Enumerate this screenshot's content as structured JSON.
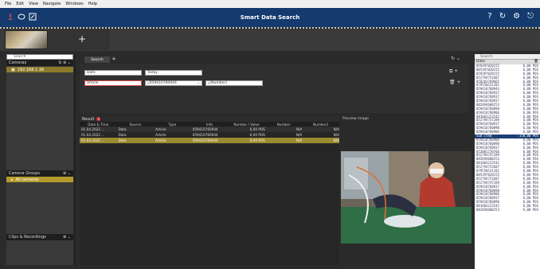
{
  "menu": [
    "File",
    "Edit",
    "View",
    "Navigate",
    "Windows",
    "Help"
  ],
  "app_title": "Smart Data Search",
  "title_right_icons": [
    "?",
    "↻",
    "⚙",
    "⎋"
  ],
  "add_tab": "+",
  "left": {
    "search_placeholder": "Search",
    "cameras_label": "Cameras",
    "camera_ip": "192.168.1.36",
    "camera_groups_label": "Camera Groups",
    "all_cameras": "All cameras",
    "clips_label": "Clips & Recordings"
  },
  "filter": {
    "tab_label": "Search",
    "tab_plus": "+",
    "field1_a": "Date",
    "field1_b": "Today",
    "field2_a": "Article",
    "field2_b": "059410760944",
    "field2_c": "(Number)"
  },
  "result": {
    "label": "Result",
    "count": "3",
    "columns": [
      "Date & Time",
      "Source",
      "Type",
      "Info",
      "Number / Value",
      "Number",
      "Number2"
    ],
    "rows": [
      [
        "01.04.2022 ...",
        "Data",
        "Article",
        "059410760944",
        "6,00 POS",
        "N/A",
        "N/A"
      ],
      [
        "01.04.2022 ...",
        "Data",
        "Article",
        "059410760944",
        "6,00 POS",
        "N/A",
        "N/A"
      ],
      [
        "01.04.2022 ...",
        "Data",
        "Article",
        "059410760944",
        "6,00 POS",
        "N/A",
        "N/A"
      ]
    ]
  },
  "preview": {
    "label": "Preview image"
  },
  "right": {
    "search_placeholder": "Search",
    "col_data": "Data",
    "rows": [
      [
        "059397020155",
        "6,00 POS"
      ],
      [
        "005397020155",
        "6,00 POS"
      ],
      [
        "059397020155",
        "6,00 POS"
      ],
      [
        "052794752687",
        "6,00 POS"
      ],
      [
        "058203769665",
        "6,00 POS"
      ],
      [
        "079550531281",
        "6,00 POS"
      ],
      [
        "059410760944",
        "6,00 POS"
      ],
      [
        "059410760937",
        "6,00 POS"
      ],
      [
        "059410760937",
        "6,00 POS"
      ],
      [
        "059410760937",
        "6,00 POS"
      ],
      [
        "082694608253",
        "6,00 POS"
      ],
      [
        "059410760890",
        "6,00 POS"
      ],
      [
        "059410760906",
        "6,00 POS"
      ],
      [
        "081603223542",
        "6,00 POS"
      ],
      [
        "052794747289",
        "6,00 POS"
      ],
      [
        "059410760937",
        "6,00 POS"
      ],
      [
        "059410760890",
        "6,00 POS"
      ],
      [
        "059410760906",
        "6,00 POS"
      ],
      [
        "Sum item",
        "-150,00 POS"
      ],
      [
        "059410760906",
        "6,00 POS"
      ],
      [
        "059410760890",
        "6,00 POS"
      ],
      [
        "059410760937",
        "6,00 POS"
      ],
      [
        "052001729766",
        "6,00 POS"
      ],
      [
        "052794747289",
        "6,00 POS"
      ],
      [
        "082694608253",
        "6,00 POS"
      ],
      [
        "081603223542",
        "6,00 POS"
      ],
      [
        "052794752687",
        "6,00 POS"
      ],
      [
        "079550531281",
        "6,00 POS"
      ],
      [
        "005397020155",
        "6,00 POS"
      ],
      [
        "052794752687",
        "6,00 POS"
      ],
      [
        "052794747289",
        "6,00 POS"
      ],
      [
        "059410760937",
        "6,00 POS"
      ],
      [
        "059410760890",
        "6,00 POS"
      ],
      [
        "059410760906",
        "6,00 POS"
      ],
      [
        "059410760937",
        "6,00 POS"
      ],
      [
        "059410760890",
        "6,00 POS"
      ],
      [
        "081603223542",
        "6,00 POS"
      ],
      [
        "082694608253",
        "6,00 POS"
      ]
    ]
  }
}
